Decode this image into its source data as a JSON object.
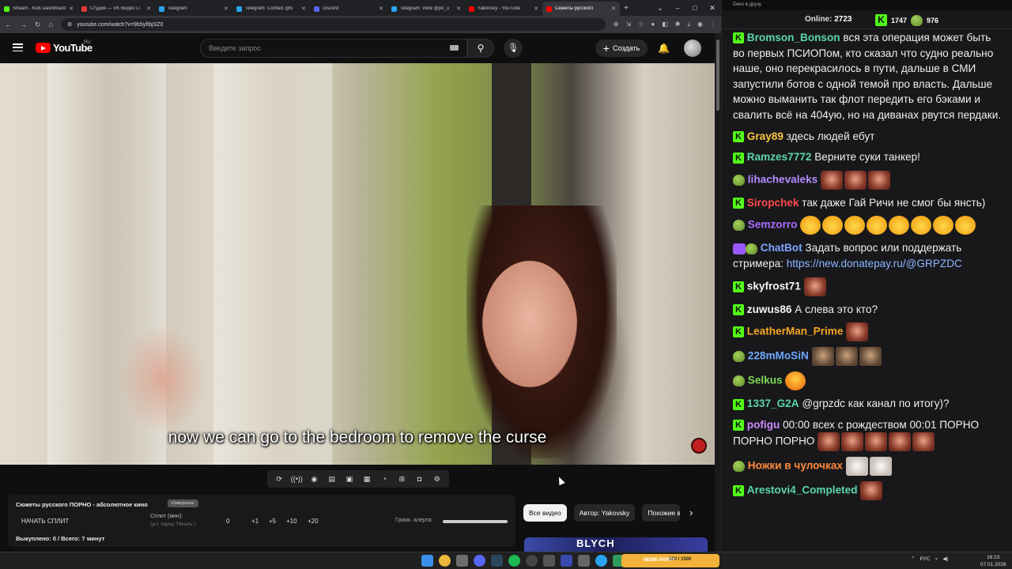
{
  "browser": {
    "tabs": [
      {
        "title": "Stream - Kick Dashboard",
        "color": "#53fc18",
        "active": false
      },
      {
        "title": "Студия — VK Видео Li",
        "color": "#e53935",
        "active": false
      },
      {
        "title": "Telegram",
        "color": "#2aa3ef",
        "active": false
      },
      {
        "title": "Telegram: Contact @b",
        "color": "#2aa3ef",
        "active": false
      },
      {
        "title": "Discord",
        "color": "#5865f2",
        "active": false
      },
      {
        "title": "Telegram: View @po_u",
        "color": "#2aa3ef",
        "active": false
      },
      {
        "title": "Yakovsky - YouTube",
        "color": "#ff0000",
        "active": false
      },
      {
        "title": "Сюжеты русского",
        "color": "#ff0000",
        "active": true
      }
    ],
    "new_tab": "+",
    "window_controls": [
      "⌄",
      "–",
      "□",
      "✕"
    ],
    "url": "youtube.com/watch?v=9b5yfIbjSZ0"
  },
  "youtube": {
    "logo_text": "YouTube",
    "region": "RU",
    "search_placeholder": "Введите запрос",
    "create_label": "Создать",
    "video": {
      "subtitle": "now we can go to the bedroom to remove the curse"
    },
    "toolbar_icons": [
      "repeat-icon",
      "broadcast-icon",
      "eye-icon",
      "clapper-icon",
      "picture-icon",
      "layout-icon",
      "speed-icon",
      "add-box-icon",
      "camera-icon",
      "gear-icon"
    ],
    "split": {
      "title": "Сюжеты русского ПОРНО - абсолютное кино",
      "tag": "Измерение",
      "start": "НАЧАТЬ СПЛИТ",
      "split_label": "Сплит (мин):",
      "split_sub": "(уст. перед \"Начать\")",
      "split_value": "0",
      "increments": [
        "+1",
        "+5",
        "+10",
        "+20"
      ],
      "volume_label": "Громк. алерта:",
      "bought": "Выкуплено: 0 / Всего: ? минут"
    },
    "chips": [
      "Все видео",
      "Автор: Yakovsky",
      "Похожие видео"
    ],
    "thumb_text": "BLYCH"
  },
  "chat": {
    "window_title": "Окно в друзу",
    "online_label": "Online:",
    "online_count": "2723",
    "kick_count": "1747",
    "other_count": "976",
    "messages": [
      {
        "badge": "kick",
        "user": "Bromson_Bonson",
        "color": "#5bd6a8",
        "text": "вся эта операция может быть во первых ПСИОПом, кто сказал что судно реально наше, оно перекрасилось в пути, дальше в СМИ запустили ботов с одной темой про власть. Дальше можно выманить так флот передить его бэками и свалить всё на 404ую, но на диванах рвутся пердаки."
      },
      {
        "badge": "kick",
        "user": "Gray89",
        "color": "#f5c542",
        "text": "здесь людей ебут"
      },
      {
        "badge": "kick",
        "user": "Ramzes7772",
        "color": "#5bd6a8",
        "text": "Верните суки танкер!"
      },
      {
        "badge": "pepe",
        "user": "lihachevaleks",
        "color": "#b38cff",
        "text": "",
        "emotes": [
          "red",
          "red",
          "red"
        ]
      },
      {
        "badge": "kick",
        "user": "Siropchek",
        "color": "#ff4a4a",
        "text": "так даже Гай Ричи не смог бы янсть)"
      },
      {
        "badge": "pepe",
        "user": "Semzorro",
        "color": "#a86bff",
        "text": "",
        "emotes": [
          "yellow",
          "yellow",
          "yellow",
          "yellow",
          "yellow",
          "yellow",
          "yellow",
          "yellow"
        ]
      },
      {
        "badge": "bot",
        "user": "ChatBot",
        "color": "#7ea6ff",
        "text": "Задать вопрос или поддержать стримера:",
        "link": "https://new.donatepay.ru/@GRPZDC"
      },
      {
        "badge": "kick",
        "user": "skyfrost71",
        "color": "#f5f5f5",
        "text": "",
        "emotes": [
          "red"
        ]
      },
      {
        "badge": "kick",
        "user": "zuwus86",
        "color": "#f5f5f5",
        "text": "А слева это кто?"
      },
      {
        "badge": "kick",
        "user": "LeatherMan_Prime",
        "color": "#f5a623",
        "text": "",
        "emotes": [
          "red"
        ]
      },
      {
        "badge": "pepe",
        "user": "228mMoSiN",
        "color": "#6ea8ff",
        "text": "",
        "emotes": [
          "face",
          "face",
          "face"
        ]
      },
      {
        "badge": "pepe",
        "user": "Selkus",
        "color": "#7ed957",
        "text": "",
        "emotes": [
          "smile"
        ]
      },
      {
        "badge": "kick",
        "user": "1337_G2A",
        "color": "#5bd6a8",
        "text": "@grpzdc как канал по итогу)?"
      },
      {
        "badge": "kick",
        "user": "pofigu",
        "color": "#c98bff",
        "text": "00:00 всех с рождеством 00:01 ПОРНО ПОРНО ПОРНО",
        "emotes": [
          "red",
          "red",
          "red",
          "red",
          "red"
        ]
      },
      {
        "badge": "pepe",
        "user": "Ножки в чулочках",
        "color": "#ff8a3d",
        "text": "",
        "emotes": [
          "cat",
          "cat"
        ]
      },
      {
        "badge": "kick",
        "user": "Arestovi4_Completed",
        "color": "#5bd6a8",
        "text": "",
        "emotes": [
          "red"
        ]
      }
    ]
  },
  "taskbar": {
    "widget_text": "500 / 1500",
    "widget_title": "MEME-PARTY",
    "lang": "РУС",
    "time": "16:23",
    "date": "07.01.2026"
  }
}
